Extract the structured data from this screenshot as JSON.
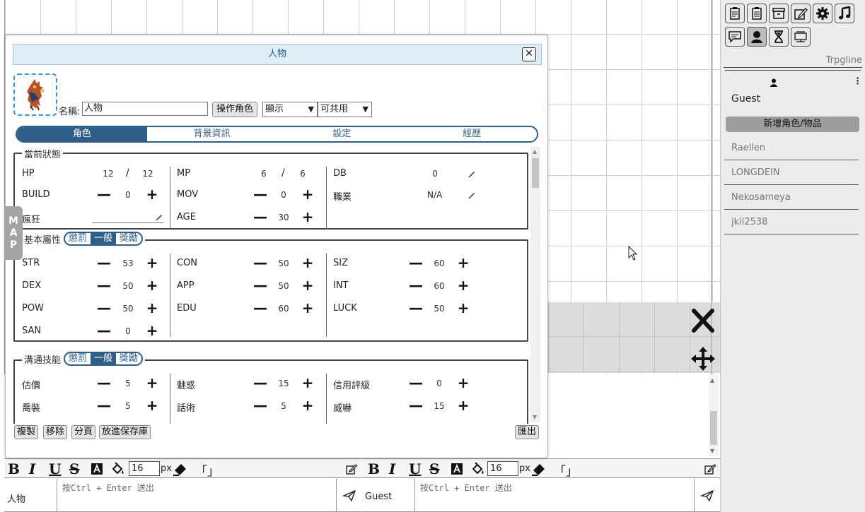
{
  "dialog": {
    "title": "人物",
    "close_label": "✕",
    "name_label": "名稱:",
    "name_value": "人物",
    "operate_button": "操作角色",
    "visibility_select": "顯示",
    "share_select": "可共用",
    "tabs": [
      "角色",
      "背景資訊",
      "設定",
      "經歷"
    ],
    "sections": {
      "status": {
        "legend": "當前狀態",
        "hp_label": "HP",
        "hp_cur": "12",
        "hp_slash": "/",
        "hp_max": "12",
        "mp_label": "MP",
        "mp_cur": "6",
        "mp_slash": "/",
        "mp_max": "6",
        "db_label": "DB",
        "db_value": "0",
        "build_label": "BUILD",
        "build_value": "0",
        "mov_label": "MOV",
        "mov_value": "0",
        "job_label": "職業",
        "job_value": "N/A",
        "madness_label": "瘋狂",
        "age_label": "AGE",
        "age_value": "30"
      },
      "attributes": {
        "legend": "基本屬性",
        "modes": [
          "懲罰",
          "一般",
          "獎勵"
        ],
        "rows": [
          [
            {
              "label": "STR",
              "value": "53"
            },
            {
              "label": "CON",
              "value": "50"
            },
            {
              "label": "SIZ",
              "value": "60"
            }
          ],
          [
            {
              "label": "DEX",
              "value": "50"
            },
            {
              "label": "APP",
              "value": "50"
            },
            {
              "label": "INT",
              "value": "60"
            }
          ],
          [
            {
              "label": "POW",
              "value": "50"
            },
            {
              "label": "EDU",
              "value": "60"
            },
            {
              "label": "LUCK",
              "value": "50"
            }
          ],
          [
            {
              "label": "SAN",
              "value": "0"
            }
          ]
        ]
      },
      "social": {
        "legend": "溝通技能",
        "modes": [
          "懲罰",
          "一般",
          "獎勵"
        ],
        "rows": [
          [
            {
              "label": "估價",
              "value": "5"
            },
            {
              "label": "魅惑",
              "value": "15"
            },
            {
              "label": "信用評級",
              "value": "0"
            }
          ],
          [
            {
              "label": "喬裝",
              "value": "5"
            },
            {
              "label": "話術",
              "value": "5"
            },
            {
              "label": "威嚇",
              "value": "15"
            }
          ]
        ]
      }
    },
    "bottom_buttons": [
      "複製",
      "移除",
      "分頁",
      "放進保存庫"
    ],
    "export_button": "匯出",
    "minus": "—",
    "plus": "+"
  },
  "map_tab": [
    "M",
    "A",
    "P"
  ],
  "right_panel": {
    "title": "Trpgline",
    "menu_glyph": "⋮",
    "guest_name": "Guest",
    "add_button": "新增角色/物品",
    "characters": [
      "Raellen",
      "LONGDEIN",
      "Nekosameya",
      "jkil2538"
    ]
  },
  "chat_left": {
    "speaker": "人物",
    "placeholder": "按Ctrl + Enter 送出",
    "font_size": "16",
    "px_label": "px",
    "quote": "「」"
  },
  "chat_right": {
    "speaker": "Guest",
    "placeholder": "按Ctrl + Enter 送出",
    "font_size": "16",
    "px_label": "px",
    "quote": "「」"
  },
  "toolbar_glyphs": {
    "bold": "B",
    "italic": "I",
    "underline": "U",
    "strike": "S"
  },
  "colors": {
    "accent": "#2f5f86",
    "title_bar": "#dfeef5",
    "panel_bg": "#ececec"
  }
}
